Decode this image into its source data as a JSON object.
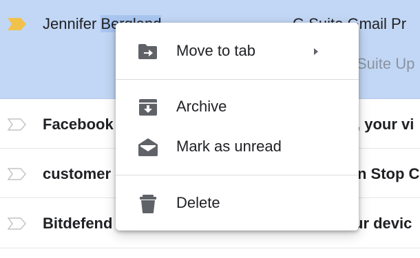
{
  "inbox": {
    "rows": [
      {
        "sender_before": "Jennifer ",
        "sender_highlight": "Bergland",
        "subject": "G Suite Gmail Pr",
        "snippet": "Suite Up"
      },
      {
        "sender": "Facebook",
        "subject": ", your vi"
      },
      {
        "sender": "customer",
        "subject": "n Stop C"
      },
      {
        "sender": "Bitdefend",
        "subject": "ur devic"
      }
    ]
  },
  "context_menu": {
    "move_to_tab": {
      "label": "Move to tab",
      "icon": "move-to-tab-icon"
    },
    "archive": {
      "label": "Archive",
      "icon": "archive-icon"
    },
    "mark_unread": {
      "label": "Mark as unread",
      "icon": "mark-unread-icon"
    },
    "delete": {
      "label": "Delete",
      "icon": "trash-icon"
    }
  },
  "colors": {
    "selected_row": "#c2d7f5",
    "importance_marker": "#f0c24b",
    "icon_gray": "#5f6368"
  }
}
